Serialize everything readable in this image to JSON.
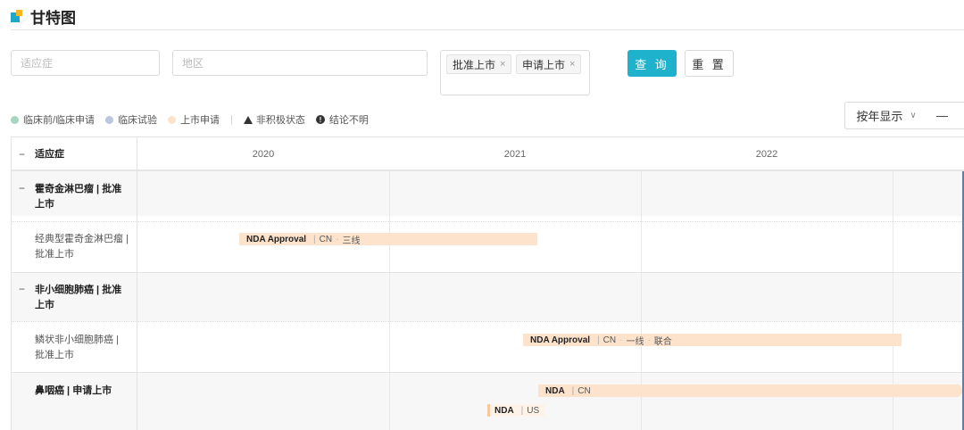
{
  "page": {
    "title": "甘特图"
  },
  "filters": {
    "indication_placeholder": "适应症",
    "indication_value": "",
    "region_placeholder": "地区",
    "region_value": "",
    "status_tags": [
      {
        "label": "批准上市",
        "close": "×"
      },
      {
        "label": "申请上市",
        "close": "×"
      }
    ],
    "query_label": "查 询",
    "reset_label": "重 置"
  },
  "legend": {
    "items": [
      {
        "label": "临床前/临床申请",
        "color": "#a8d5bf"
      },
      {
        "label": "临床试验",
        "color": "#b9c6dc"
      },
      {
        "label": "上市申请",
        "color": "#fde3cc"
      }
    ],
    "separator": "|",
    "inactive_label": "非积极状态",
    "unclear_label": "结论不明"
  },
  "view": {
    "mode_label": "按年显示",
    "chevron": "∨",
    "zoom_out": "—",
    "zoom_in": "+"
  },
  "gantt": {
    "first_col_header": "适应症",
    "collapse_symbol": "−",
    "years": [
      "2020",
      "2021",
      "2022"
    ],
    "groups": [
      {
        "label": "霍奇金淋巴瘤 | 批准上市",
        "children": [
          {
            "label": "经典型霍奇金淋巴瘤 | 批准上市",
            "bars": [
              {
                "type": "NDA Approval",
                "sep": "|",
                "region": "CN",
                "dot": "·",
                "line": "三线",
                "extra": ""
              }
            ]
          }
        ]
      },
      {
        "label": "非小细胞肺癌 | 批准上市",
        "children": [
          {
            "label": "鳞状非小细胞肺癌 | 批准上市",
            "bars": [
              {
                "type": "NDA Approval",
                "sep": "|",
                "region": "CN",
                "dot": "·",
                "line": "一线",
                "extra": "联合"
              }
            ]
          }
        ]
      },
      {
        "label": "鼻咽癌 | 申请上市",
        "bars": [
          {
            "type": "NDA",
            "sep": "|",
            "region": "CN"
          },
          {
            "type": "NDA",
            "sep": "|",
            "region": "US"
          }
        ]
      }
    ]
  }
}
